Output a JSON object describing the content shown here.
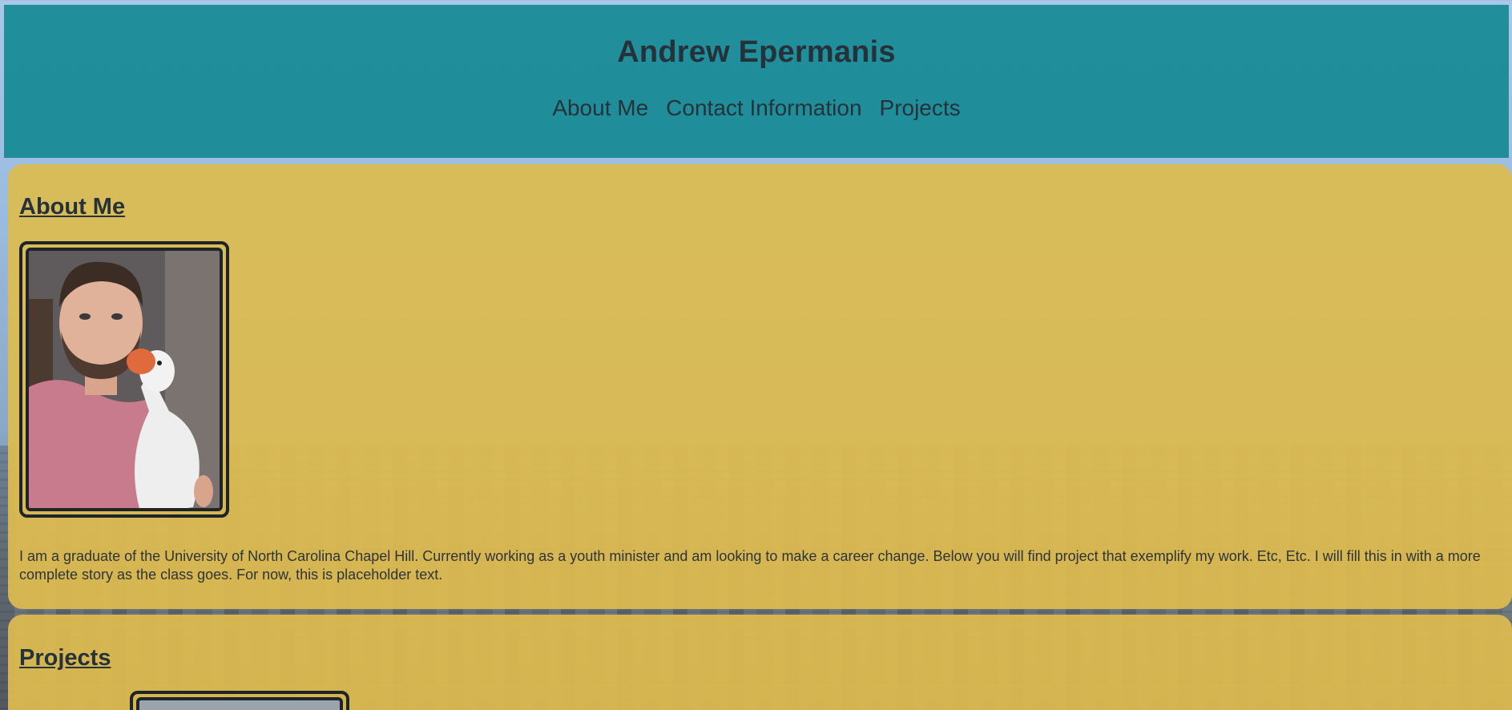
{
  "header": {
    "title": "Andrew Epermanis",
    "nav": [
      {
        "label": "About Me"
      },
      {
        "label": "Contact Information"
      },
      {
        "label": "Projects"
      }
    ]
  },
  "about": {
    "heading": "About Me",
    "text": "I am a graduate of the University of North Carolina Chapel Hill. Currently working as a youth minister and am looking to make a career change. Below you will find project that exemplify my work. Etc, Etc. I will fill this in with a more complete story as the class goes. For now, this is placeholder text."
  },
  "projects": {
    "heading": "Projects"
  },
  "colors": {
    "header_bg": "#168a94",
    "panel_bg": "#debc4e",
    "text": "#26323a"
  }
}
